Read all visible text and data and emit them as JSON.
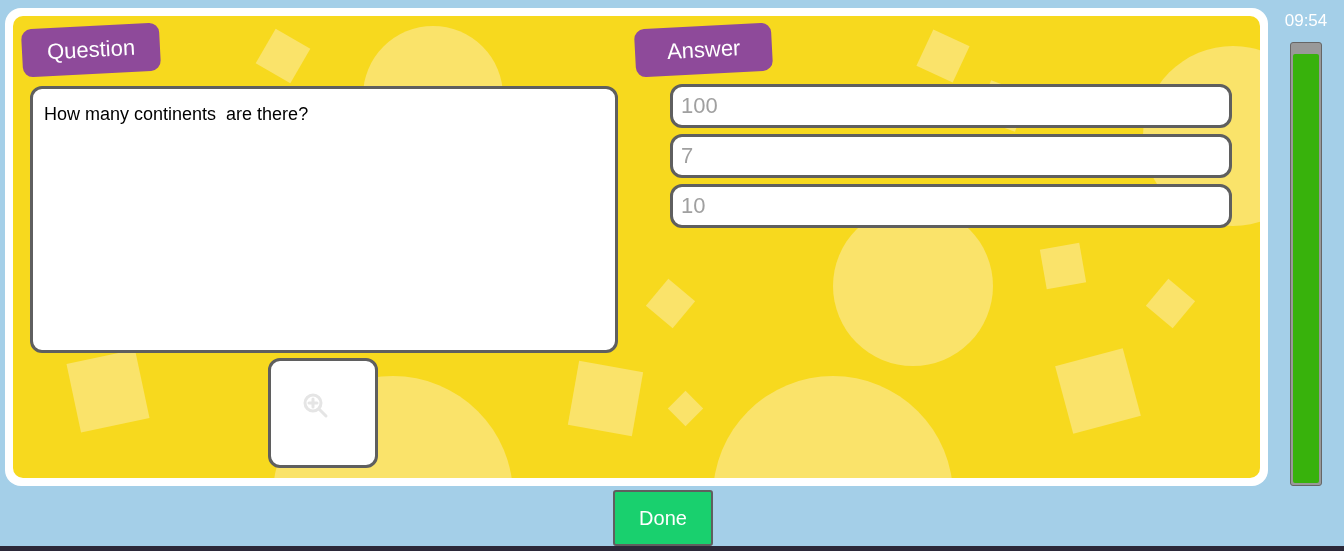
{
  "question": {
    "label": "Question",
    "text": "How many continents  are there?"
  },
  "answer": {
    "label": "Answer",
    "options": [
      {
        "placeholder": "100"
      },
      {
        "placeholder": "7"
      },
      {
        "placeholder": "10"
      }
    ]
  },
  "timer": {
    "time": "09:54",
    "level": 0.98
  },
  "done_button": "Done"
}
